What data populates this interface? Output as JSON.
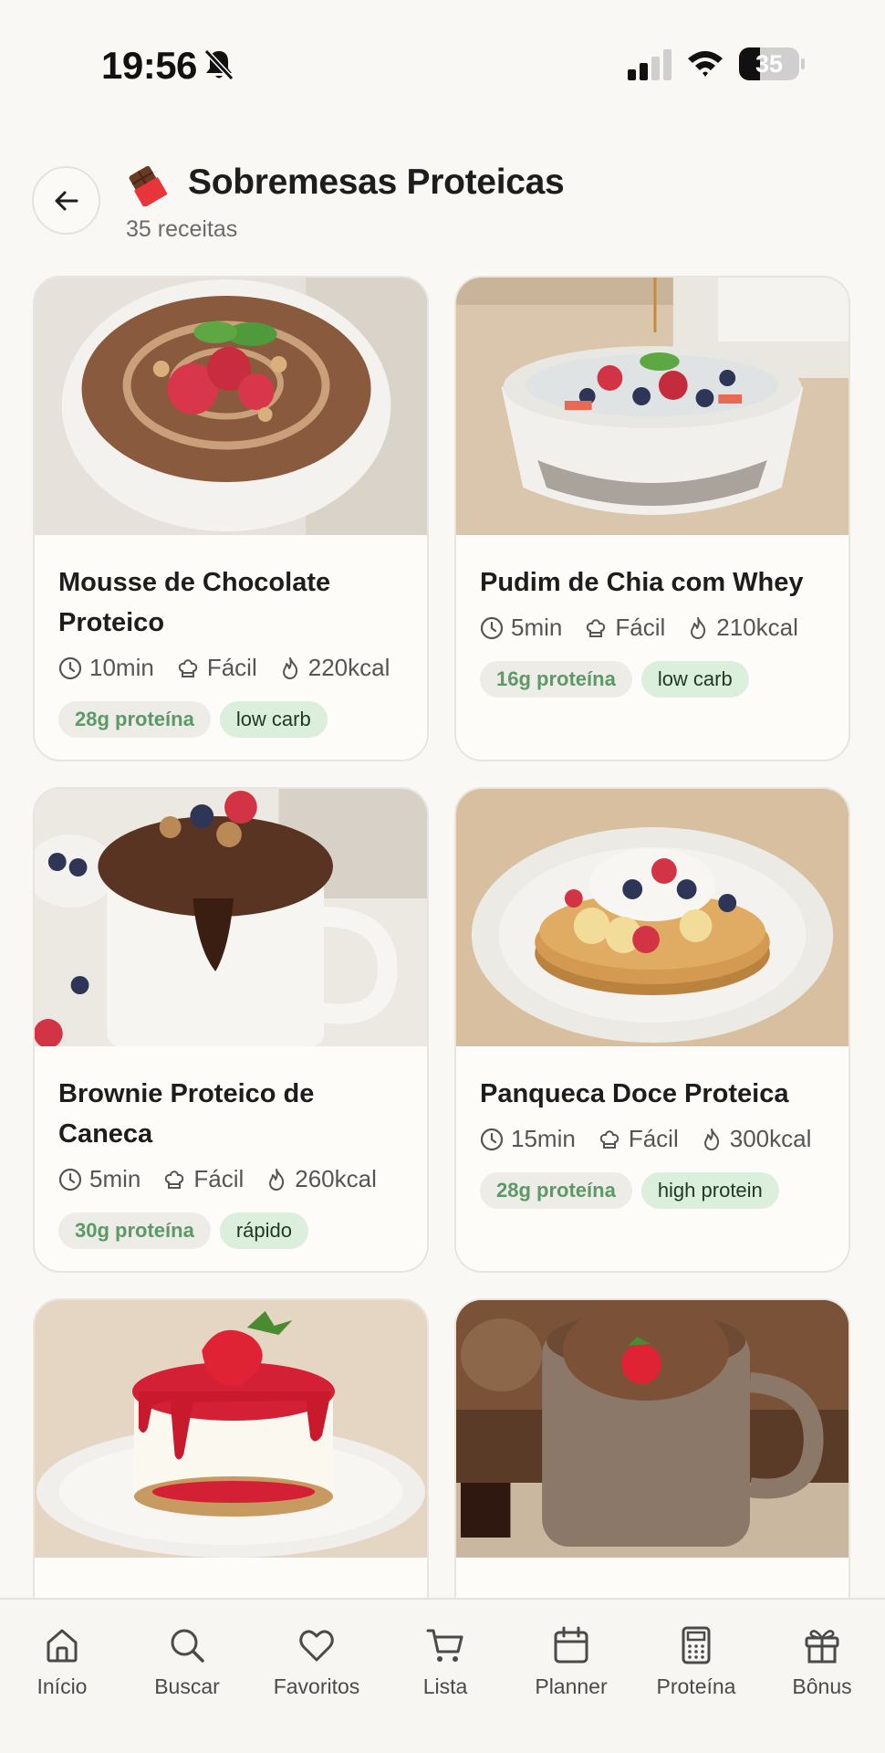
{
  "status_bar": {
    "time": "19:56",
    "battery": "35",
    "battery_level": 0.35
  },
  "header": {
    "emoji": "chocolate-bar",
    "title": "Sobremesas Proteicas",
    "subtitle": "35 receitas"
  },
  "cards": [
    {
      "title": "Mousse de Chocolate Proteico",
      "time": "10min",
      "difficulty": "Fácil",
      "calories": "220kcal",
      "protein": "28g proteína",
      "tag": "low carb",
      "image": "chocolate-mousse-bowl"
    },
    {
      "title": "Pudim de Chia com Whey",
      "time": "5min",
      "difficulty": "Fácil",
      "calories": "210kcal",
      "protein": "16g proteína",
      "tag": "low carb",
      "image": "chia-pudding-bowl"
    },
    {
      "title": "Brownie Proteico de Caneca",
      "time": "5min",
      "difficulty": "Fácil",
      "calories": "260kcal",
      "protein": "30g proteína",
      "tag": "rápido",
      "image": "mug-brownie"
    },
    {
      "title": "Panqueca Doce Proteica",
      "time": "15min",
      "difficulty": "Fácil",
      "calories": "300kcal",
      "protein": "28g proteína",
      "tag": "high protein",
      "image": "sweet-pancake"
    },
    {
      "title": "",
      "image": "strawberry-cheesecake"
    },
    {
      "title": "",
      "image": "mug-cake"
    }
  ],
  "nav": [
    {
      "label": "Início",
      "icon": "home-icon"
    },
    {
      "label": "Buscar",
      "icon": "search-icon"
    },
    {
      "label": "Favoritos",
      "icon": "heart-icon"
    },
    {
      "label": "Lista",
      "icon": "cart-icon"
    },
    {
      "label": "Planner",
      "icon": "calendar-icon"
    },
    {
      "label": "Proteína",
      "icon": "calculator-icon"
    },
    {
      "label": "Bônus",
      "icon": "gift-icon"
    }
  ]
}
